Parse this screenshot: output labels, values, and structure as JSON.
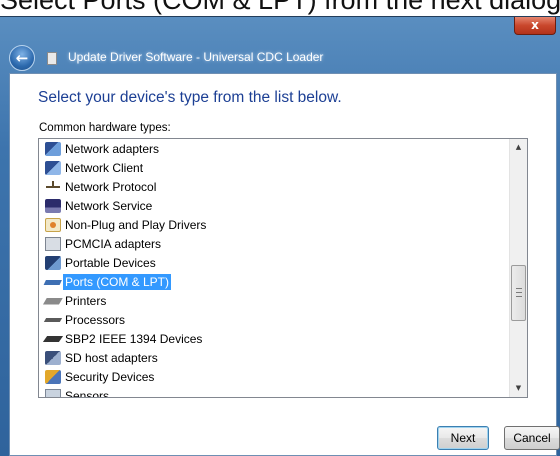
{
  "caption": {
    "text": "Select Ports (COM & LPT) from the next dialog"
  },
  "window": {
    "title": "Update Driver Software - Universal CDC Loader",
    "close_glyph": "x",
    "back_glyph": "←"
  },
  "dialog": {
    "heading": "Select your device's type from the list below.",
    "list_label": "Common hardware types:",
    "items": [
      {
        "label": "Network adapters",
        "icon": "network-adapter-icon"
      },
      {
        "label": "Network Client",
        "icon": "network-client-icon"
      },
      {
        "label": "Network Protocol",
        "icon": "network-protocol-icon"
      },
      {
        "label": "Network Service",
        "icon": "network-service-icon"
      },
      {
        "label": "Non-Plug and Play Drivers",
        "icon": "non-pnp-driver-icon"
      },
      {
        "label": "PCMCIA adapters",
        "icon": "pcmcia-icon"
      },
      {
        "label": "Portable Devices",
        "icon": "portable-device-icon"
      },
      {
        "label": "Ports (COM & LPT)",
        "icon": "port-icon",
        "selected": true
      },
      {
        "label": "Printers",
        "icon": "printer-icon"
      },
      {
        "label": "Processors",
        "icon": "processor-icon"
      },
      {
        "label": "SBP2 IEEE 1394 Devices",
        "icon": "ieee1394-icon"
      },
      {
        "label": "SD host adapters",
        "icon": "sd-adapter-icon"
      },
      {
        "label": "Security Devices",
        "icon": "security-device-icon"
      },
      {
        "label": "Sensors",
        "icon": "sensor-icon"
      }
    ],
    "scroll_up_glyph": "▲",
    "scroll_down_glyph": "▼"
  },
  "buttons": {
    "next": "Next",
    "cancel": "Cancel"
  },
  "colors": {
    "frame": "#3d74ad",
    "heading": "#1c3f94",
    "selection": "#3399ff",
    "close": "#c9472c"
  }
}
